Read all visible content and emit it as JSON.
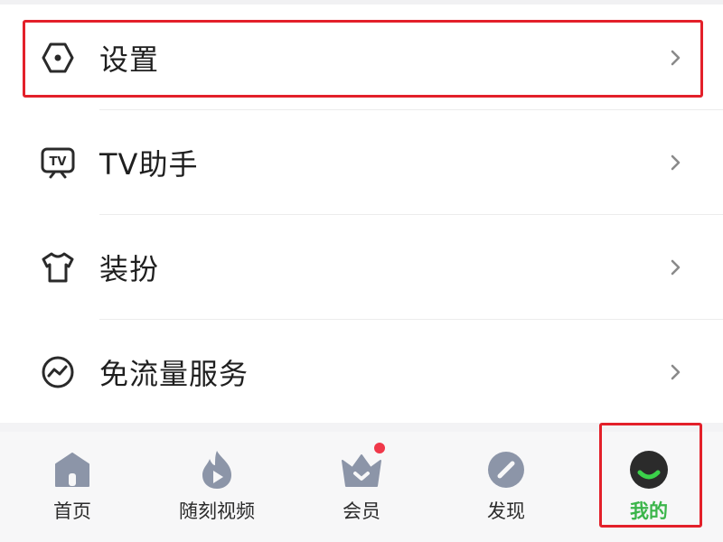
{
  "menu": {
    "items": [
      {
        "key": "settings",
        "label": "设置",
        "icon": "hexagon-settings-icon"
      },
      {
        "key": "tv",
        "label": "TV助手",
        "icon": "tv-icon"
      },
      {
        "key": "dressup",
        "label": "装扮",
        "icon": "tshirt-icon"
      },
      {
        "key": "freeflow",
        "label": "免流量服务",
        "icon": "wave-circle-icon"
      }
    ]
  },
  "tabbar": {
    "tabs": [
      {
        "label": "首页",
        "icon": "home-icon"
      },
      {
        "label": "随刻视频",
        "icon": "flame-play-icon"
      },
      {
        "label": "会员",
        "icon": "crown-icon",
        "badge": true
      },
      {
        "label": "发现",
        "icon": "compass-icon"
      },
      {
        "label": "我的",
        "icon": "avatar-icon",
        "active": true
      }
    ]
  },
  "colors": {
    "accent": "#3bb54a",
    "highlight": "#e3202a",
    "icon_gray": "#8c95a8",
    "badge": "#f0384a"
  }
}
